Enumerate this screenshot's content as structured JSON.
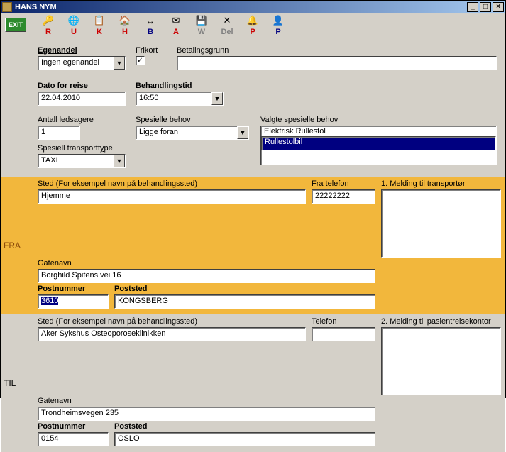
{
  "title": "HANS NYM",
  "winbtns": {
    "min": "_",
    "max": "□",
    "close": "×"
  },
  "toolbar": {
    "exit": "EXIT",
    "items": [
      {
        "icon": "🔑",
        "label": "R",
        "cls": "red",
        "name": "tb-r-button"
      },
      {
        "icon": "🌐",
        "label": "U",
        "cls": "red",
        "name": "tb-u-button"
      },
      {
        "icon": "📋",
        "label": "K",
        "cls": "red",
        "name": "tb-k-button"
      },
      {
        "icon": "🏠",
        "label": "H",
        "cls": "red",
        "name": "tb-h-button"
      },
      {
        "icon": "↔",
        "label": "B",
        "cls": "navy",
        "name": "tb-b-button"
      },
      {
        "icon": "✉",
        "label": "A",
        "cls": "red",
        "name": "tb-a-button"
      },
      {
        "icon": "💾",
        "label": "W",
        "cls": "gray",
        "name": "tb-w-button"
      },
      {
        "icon": "✕",
        "label": "Del",
        "cls": "gray",
        "name": "tb-del-button"
      },
      {
        "icon": "🔔",
        "label": "P",
        "cls": "red",
        "name": "tb-p1-button"
      },
      {
        "icon": "👤",
        "label": "P",
        "cls": "navy",
        "name": "tb-p2-button"
      }
    ]
  },
  "labels": {
    "egenandel": "Egenandel",
    "frikort": "Frikort",
    "betalingsgrunn": "Betalingsgrunn",
    "dato": "Dato for reise",
    "behandlingstid": "Behandlingstid",
    "ledsagere": "Antall ledsagere",
    "spesielle": "Spesielle behov",
    "valgte": "Valgte spesielle behov",
    "transporttype": "Spesiell transporttype",
    "fra": "FRA",
    "til": "TIL",
    "sted": "Sted (For eksempel navn på behandlingssted)",
    "telefon_fra": "Fra telefon",
    "telefon": "Telefon",
    "melding1": "1. Melding til transportør",
    "melding2": "2. Melding til pasientreisekontor",
    "gatenavn": "Gatenavn",
    "postnummer": "Postnummer",
    "poststed": "Poststed"
  },
  "values": {
    "egenandel": "Ingen egenandel",
    "frikort_checked": "✓",
    "betalingsgrunn": "",
    "dato": "22.04.2010",
    "behandlingstid": "16:50",
    "ledsagere": "1",
    "spesielle": "Ligge foran",
    "transporttype": "TAXI",
    "valgte_items": [
      "Elektrisk Rullestol",
      "Rullestolbil"
    ],
    "fra": {
      "sted": "Hjemme",
      "telefon": "22222222",
      "gate": "Borghild Spitens vei 16",
      "postnr": "3610",
      "poststed": "KONGSBERG",
      "melding": ""
    },
    "til": {
      "sted": "Aker Sykshus Osteoporoseklinikken",
      "telefon": "",
      "gate": "Trondheimsvegen 235",
      "postnr": "0154",
      "poststed": "OSLO",
      "melding": ""
    }
  }
}
